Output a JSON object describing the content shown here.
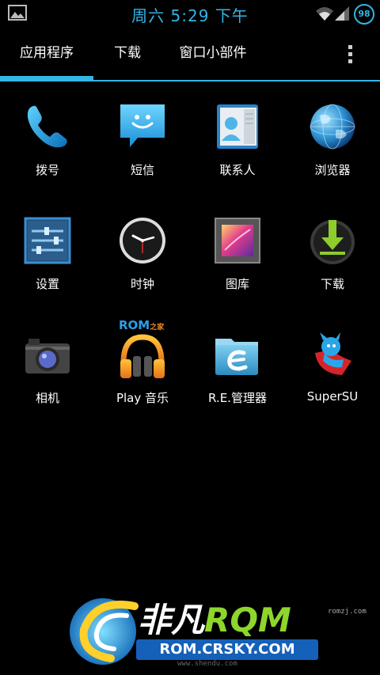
{
  "status_bar": {
    "time": "周六 5:29 下午",
    "battery_level": "98",
    "accent_color": "#33b5e5",
    "icons": [
      "gallery-notification-icon",
      "wifi-icon",
      "signal-icon",
      "battery-icon"
    ]
  },
  "tabs": [
    {
      "label": "应用程序",
      "selected": true
    },
    {
      "label": "下载",
      "selected": false
    },
    {
      "label": "窗口小部件",
      "selected": false
    }
  ],
  "apps": [
    {
      "label": "拨号",
      "icon": "phone-icon"
    },
    {
      "label": "短信",
      "icon": "messaging-icon"
    },
    {
      "label": "联系人",
      "icon": "contacts-icon"
    },
    {
      "label": "浏览器",
      "icon": "browser-globe-icon"
    },
    {
      "label": "设置",
      "icon": "settings-icon"
    },
    {
      "label": "时钟",
      "icon": "clock-icon"
    },
    {
      "label": "图库",
      "icon": "gallery-icon"
    },
    {
      "label": "下载",
      "icon": "download-icon"
    },
    {
      "label": "相机",
      "icon": "camera-icon"
    },
    {
      "label": "Play 音乐",
      "icon": "play-music-icon"
    },
    {
      "label": "R.E.管理器",
      "icon": "file-manager-icon"
    },
    {
      "label": "SuperSU",
      "icon": "supersu-icon"
    }
  ],
  "watermark": {
    "brand_cn": "非凡",
    "brand_en": "RQM",
    "url": "ROM.CRSKY.COM",
    "small_top": "romzj.com",
    "small_bottom": "www.shendu.com",
    "rom_badge": "ROM",
    "rom_badge_cn": "之家"
  }
}
